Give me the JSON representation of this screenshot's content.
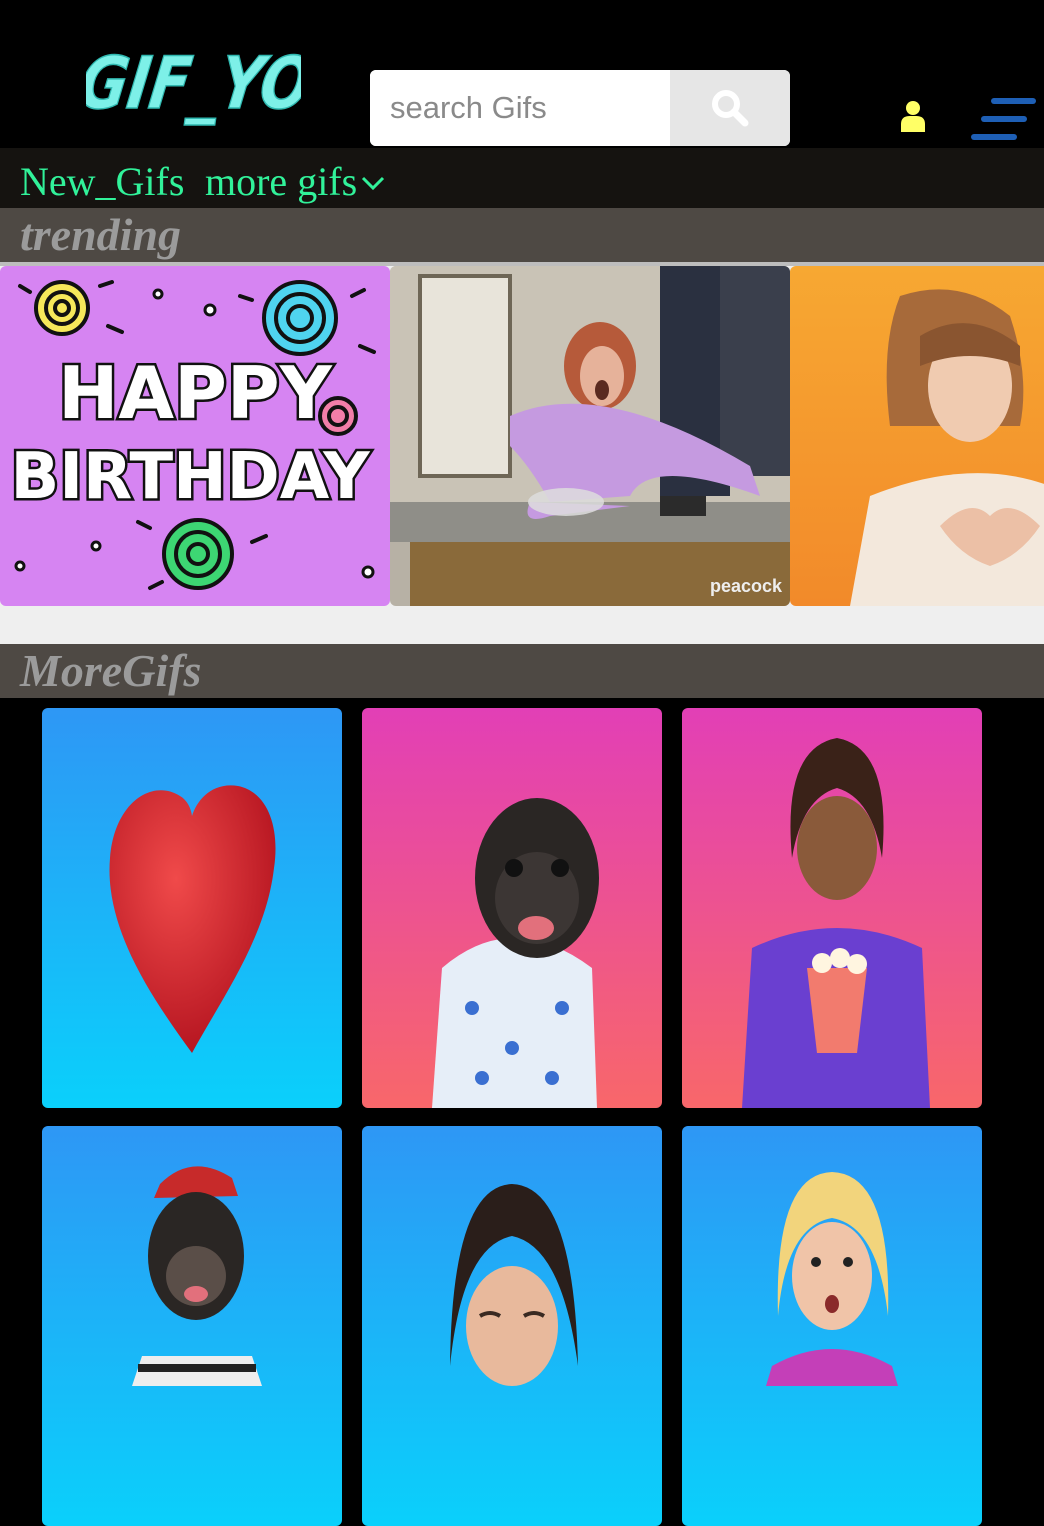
{
  "header": {
    "logo_text": "GIF_YOU",
    "search": {
      "placeholder": "search Gifs",
      "value": ""
    }
  },
  "nav": {
    "new_gifs": "New_Gifs",
    "more_gifs": "more gifs"
  },
  "sections": {
    "trending": "trending",
    "more": "MoreGifs"
  },
  "trending_gifs": {
    "birthday_line1": "HAPPY",
    "birthday_line2": "BIRTHDAY",
    "watermark": "peacock"
  },
  "colors": {
    "nav_text": "#31f29a",
    "logo": "#7df0e8",
    "user_icon": "#ffff66",
    "menu_icon": "#1e5fb5"
  }
}
